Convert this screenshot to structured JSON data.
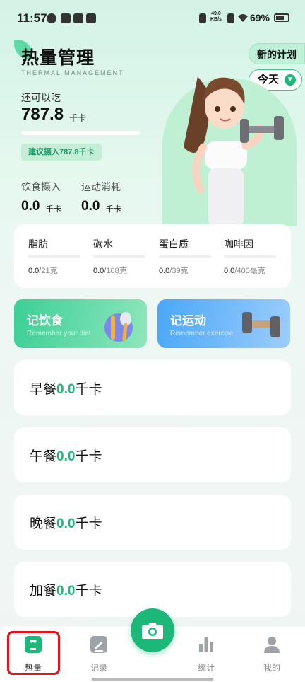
{
  "status_bar": {
    "time": "11:57",
    "net_speed_value": "49.0",
    "net_speed_unit": "KB/s",
    "battery": "69%"
  },
  "header": {
    "title": "热量管理",
    "subtitle": "THERMAL MANAGEMENT",
    "new_plan_label": "新的计划",
    "date_selector": "今天"
  },
  "summary": {
    "remaining_label": "还可以吃",
    "remaining_value": "787.8",
    "remaining_unit": "千卡",
    "remaining_progress": 0,
    "suggest_label": "建议摄入787.8千卡",
    "intake_label": "饮食摄入",
    "intake_value": "0.0",
    "intake_unit": "千卡",
    "burn_label": "运动消耗",
    "burn_value": "0.0",
    "burn_unit": "千卡"
  },
  "nutrients": [
    {
      "name": "脂肪",
      "value": "0.0",
      "limit": "/21克",
      "progress": 0
    },
    {
      "name": "碳水",
      "value": "0.0",
      "limit": "/108克",
      "progress": 0
    },
    {
      "name": "蛋白质",
      "value": "0.0",
      "limit": "/39克",
      "progress": 0
    },
    {
      "name": "咖啡因",
      "value": "0.0",
      "limit": "/400毫克",
      "progress": 0
    }
  ],
  "actions": {
    "diet_title": "记饮食",
    "diet_subtitle": "Remember your diet",
    "exercise_title": "记运动",
    "exercise_subtitle": "Remember exercise"
  },
  "meals": [
    {
      "name": "早餐",
      "value": "0.0",
      "unit": "千卡"
    },
    {
      "name": "午餐",
      "value": "0.0",
      "unit": "千卡"
    },
    {
      "name": "晚餐",
      "value": "0.0",
      "unit": "千卡"
    },
    {
      "name": "加餐",
      "value": "0.0",
      "unit": "千卡"
    }
  ],
  "bottom_nav": {
    "items": [
      {
        "label": "热量",
        "icon": "scale-icon",
        "active": true
      },
      {
        "label": "记录",
        "icon": "edit-note-icon",
        "active": false
      },
      {
        "label": "统计",
        "icon": "bar-chart-icon",
        "active": false
      },
      {
        "label": "我的",
        "icon": "person-icon",
        "active": false
      }
    ],
    "camera_icon": "camera-icon"
  },
  "colors": {
    "accent": "#1cb87a",
    "exercise_blue": "#4aa7f8",
    "highlight_red": "#e0171f"
  }
}
